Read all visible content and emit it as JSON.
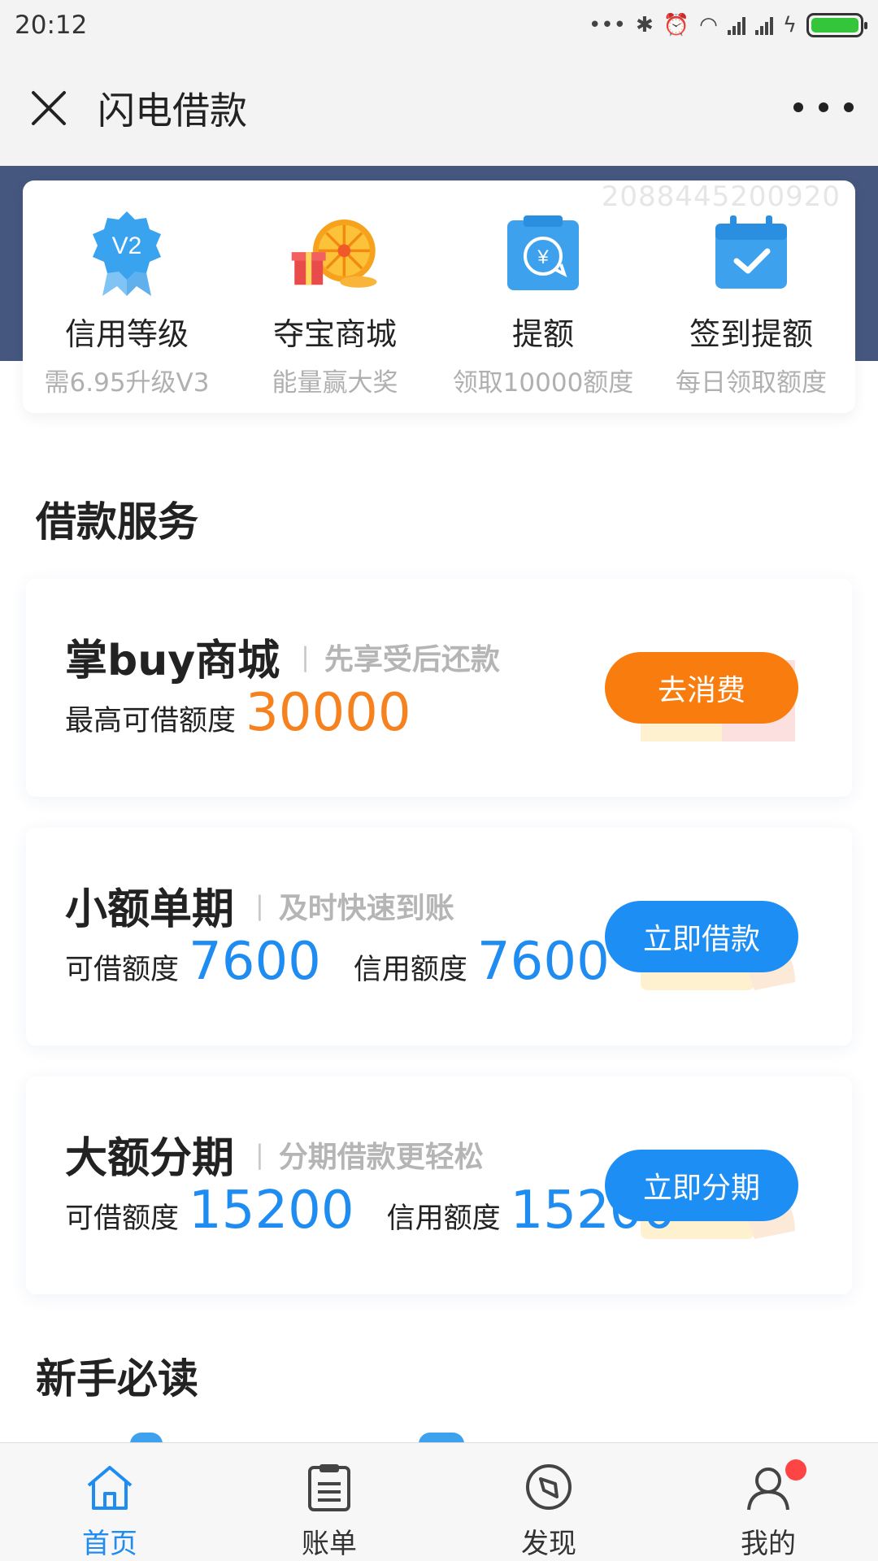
{
  "status_bar": {
    "time": "20:12",
    "battery_level": 1.0
  },
  "nav": {
    "title": "闪电借款"
  },
  "quick": {
    "user_id": "2088445200920",
    "items": [
      {
        "label": "信用等级",
        "sub": "需6.95升级V3",
        "icon": "badge-v2-icon",
        "badge_text": "V2"
      },
      {
        "label": "夺宝商城",
        "sub": "能量赢大奖",
        "icon": "prize-wheel-icon"
      },
      {
        "label": "提额",
        "sub": "领取10000额度",
        "icon": "quota-increase-icon"
      },
      {
        "label": "签到提额",
        "sub": "每日领取额度",
        "icon": "calendar-check-icon"
      }
    ]
  },
  "sections": {
    "loan_services": "借款服务",
    "newbie": "新手必读"
  },
  "cards": [
    {
      "name": "掌buy商城",
      "slogan": "先享受后还款",
      "line1_label": "最高可借额度",
      "line1_value": "30000",
      "button": "去消费"
    },
    {
      "name": "小额单期",
      "slogan": "及时快速到账",
      "line1_label": "可借额度",
      "line1_value": "7600",
      "line2_label": "信用额度",
      "line2_value": "7600",
      "button": "立即借款"
    },
    {
      "name": "大额分期",
      "slogan": "分期借款更轻松",
      "line1_label": "可借额度",
      "line1_value": "15200",
      "line2_label": "信用额度",
      "line2_value": "15200",
      "button": "立即分期"
    }
  ],
  "tabs": [
    {
      "label": "首页",
      "icon": "home-icon",
      "active": true
    },
    {
      "label": "账单",
      "icon": "bill-icon",
      "active": false
    },
    {
      "label": "发现",
      "icon": "compass-icon",
      "active": false
    },
    {
      "label": "我的",
      "icon": "user-icon",
      "active": false
    }
  ],
  "colors": {
    "header_band": "#46577f",
    "accent_orange": "#f87c0e",
    "accent_blue": "#1d8ef3",
    "badge_red": "#ff4444"
  }
}
